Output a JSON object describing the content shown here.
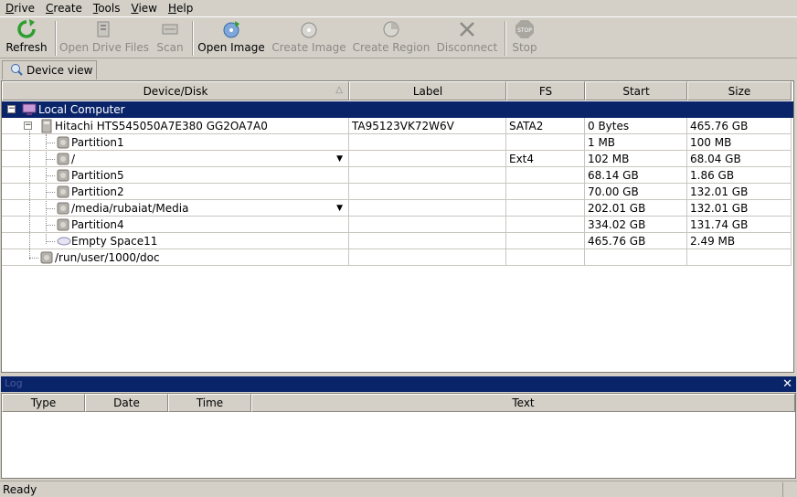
{
  "menu": [
    {
      "first": "D",
      "rest": "rive"
    },
    {
      "first": "C",
      "rest": "reate"
    },
    {
      "first": "T",
      "rest": "ools"
    },
    {
      "first": "V",
      "rest": "iew"
    },
    {
      "first": "H",
      "rest": "elp"
    }
  ],
  "toolbar": {
    "refresh": "Refresh",
    "open_drive_files": "Open Drive Files",
    "scan": "Scan",
    "open_image": "Open Image",
    "create_image": "Create Image",
    "create_region": "Create Region",
    "disconnect": "Disconnect",
    "stop": "Stop",
    "stop_icon_text": "STOP"
  },
  "tabs": {
    "device_view": "Device view"
  },
  "tree": {
    "columns": [
      "Device/Disk",
      "Label",
      "FS",
      "Start",
      "Size"
    ],
    "root": "Local Computer",
    "rows": [
      {
        "name": "Hitachi HTS545050A7E380 GG2OA7A0",
        "label": "TA95123VK72W6V",
        "fs": "SATA2",
        "start": "0 Bytes",
        "size": "465.76 GB"
      },
      {
        "name": "Partition1",
        "label": "",
        "fs": "",
        "start": "1 MB",
        "size": "100 MB"
      },
      {
        "name": "/",
        "label": "",
        "fs": "Ext4",
        "start": "102 MB",
        "size": "68.04 GB"
      },
      {
        "name": "Partition5",
        "label": "",
        "fs": "",
        "start": "68.14 GB",
        "size": "1.86 GB"
      },
      {
        "name": "Partition2",
        "label": "",
        "fs": "",
        "start": "70.00 GB",
        "size": "132.01 GB"
      },
      {
        "name": "/media/rubaiat/Media",
        "label": "",
        "fs": "",
        "start": "202.01 GB",
        "size": "132.01 GB"
      },
      {
        "name": "Partition4",
        "label": "",
        "fs": "",
        "start": "334.02 GB",
        "size": "131.74 GB"
      },
      {
        "name": "Empty Space11",
        "label": "",
        "fs": "",
        "start": "465.76 GB",
        "size": "2.49 MB"
      },
      {
        "name": "/run/user/1000/doc",
        "label": "",
        "fs": "",
        "start": "",
        "size": ""
      }
    ]
  },
  "log": {
    "title": "Log",
    "columns": [
      "Type",
      "Date",
      "Time",
      "Text"
    ]
  },
  "status": {
    "text": "Ready"
  },
  "colors": {
    "selection": "#0a246a",
    "chrome": "#d4d0c8",
    "refresh_green": "#2e9e2e"
  }
}
